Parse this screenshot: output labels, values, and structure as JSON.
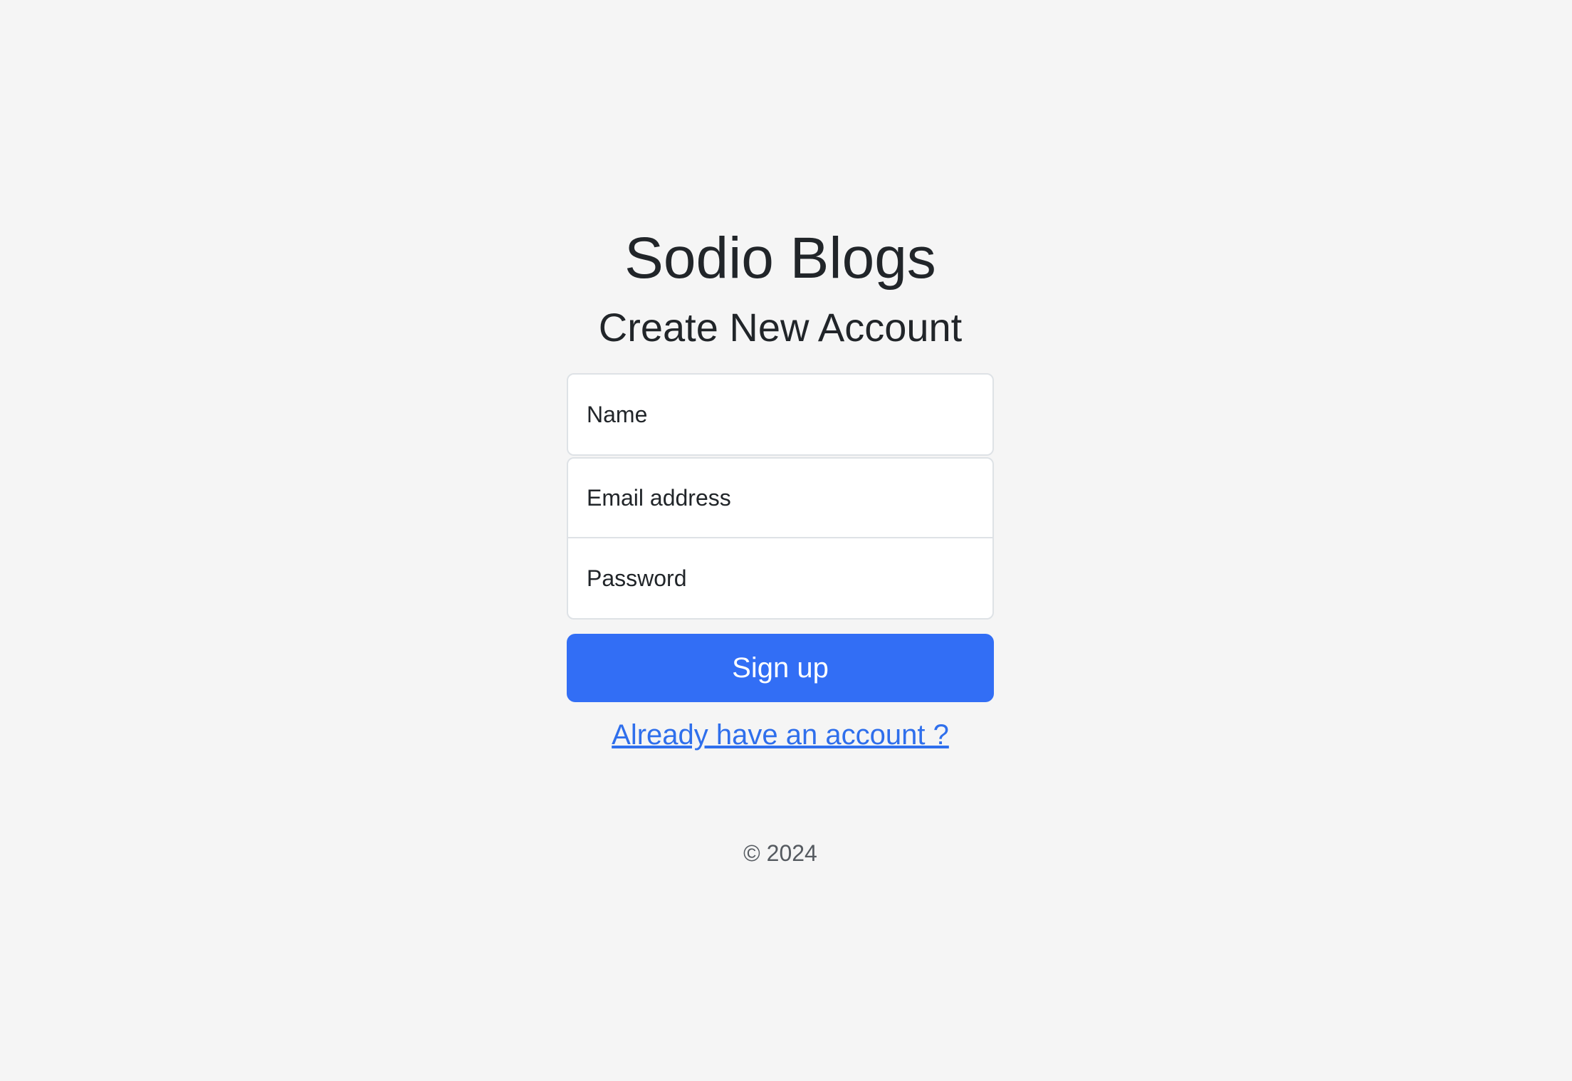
{
  "app": {
    "brand": "Sodio Blogs",
    "subtitle": "Create New Account"
  },
  "form": {
    "name": {
      "placeholder": "Name",
      "value": ""
    },
    "email": {
      "placeholder": "Email address",
      "value": ""
    },
    "password": {
      "placeholder": "Password",
      "value": ""
    },
    "submit_label": "Sign up",
    "login_link": "Already have an account ?"
  },
  "footer": {
    "copyright": "© 2024"
  },
  "colors": {
    "background": "#f5f5f5",
    "primary": "#326ef5",
    "link": "#2f6fec",
    "text": "#212529"
  }
}
